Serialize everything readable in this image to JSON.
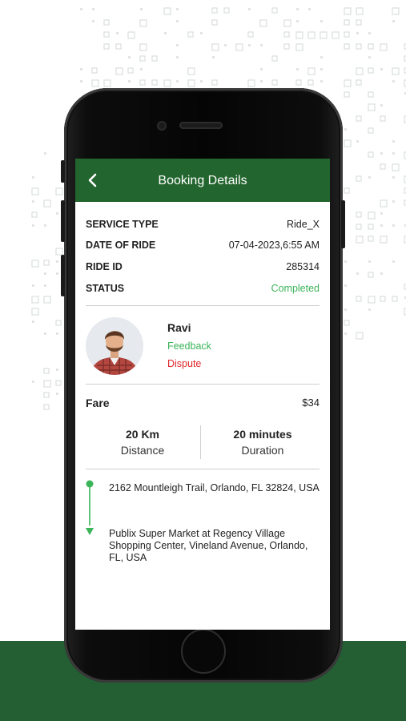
{
  "header": {
    "title": "Booking Details"
  },
  "details": [
    {
      "label": "SERVICE TYPE",
      "value": "Ride_X"
    },
    {
      "label": "DATE OF RIDE",
      "value": "07-04-2023,6:55 AM"
    },
    {
      "label": "RIDE ID",
      "value": "285314"
    },
    {
      "label": "STATUS",
      "value": "Completed"
    }
  ],
  "driver": {
    "name": "Ravi",
    "feedback": "Feedback",
    "dispute": "Dispute"
  },
  "fare": {
    "label": "Fare",
    "value": "$34"
  },
  "trip": {
    "distance_value": "20 Km",
    "distance_label": "Distance",
    "duration_value": "20 minutes",
    "duration_label": "Duration"
  },
  "route": {
    "pickup": "2162 Mountleigh Trail, Orlando, FL 32824, USA",
    "dropoff": "Publix Super Market at Regency Village Shopping Center, Vineland Avenue, Orlando, FL, USA"
  },
  "colors": {
    "brand_green": "#23652f",
    "status_green": "#3cb45a",
    "dispute_red": "#e0262b",
    "background_band": "#245f34"
  }
}
